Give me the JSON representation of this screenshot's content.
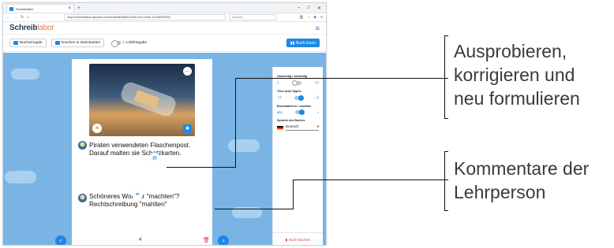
{
  "browser": {
    "tab_title": "Schreiblabor",
    "url": "https://schreiblabor.dybuster.com/book/9ab28083-605e-447e-be0e-1e158087b051",
    "search_placeholder": "Suchen",
    "window_controls": [
      "–",
      "□",
      "✕"
    ]
  },
  "app": {
    "logo_main": "Schreib",
    "logo_lab": "labor",
    "menu_icon": "hamburger-icon"
  },
  "toolbar": {
    "bookshelf_label": "Bücherregale",
    "print_label": "Drucken & downloaden",
    "share_label": "Linkfreigabe",
    "read_label": "Buch lesen"
  },
  "page": {
    "text1": "Piraten verwendeten Flaschenpost. Darauf malten sie Schatzkarten.",
    "text2": "Schöneres Wort für \"machten\"? Rechtschreibung \"mahlten\"",
    "page_number": "4"
  },
  "panel": {
    "label_layout": "Ganzseitig / zweiseitig",
    "label_typing": "Töne beim Tippen",
    "label_letters": "Buchstabieren / Lauttöne",
    "label_language": "Sprache des Buches",
    "language_value": "Deutsch",
    "letters_value": "abc",
    "delete_book": "Buch löschen"
  },
  "callouts": {
    "first": [
      "Ausprobieren,",
      "korrigieren und",
      "neu formulieren"
    ],
    "second": [
      "Kommentare der",
      "Lehrperson"
    ]
  }
}
